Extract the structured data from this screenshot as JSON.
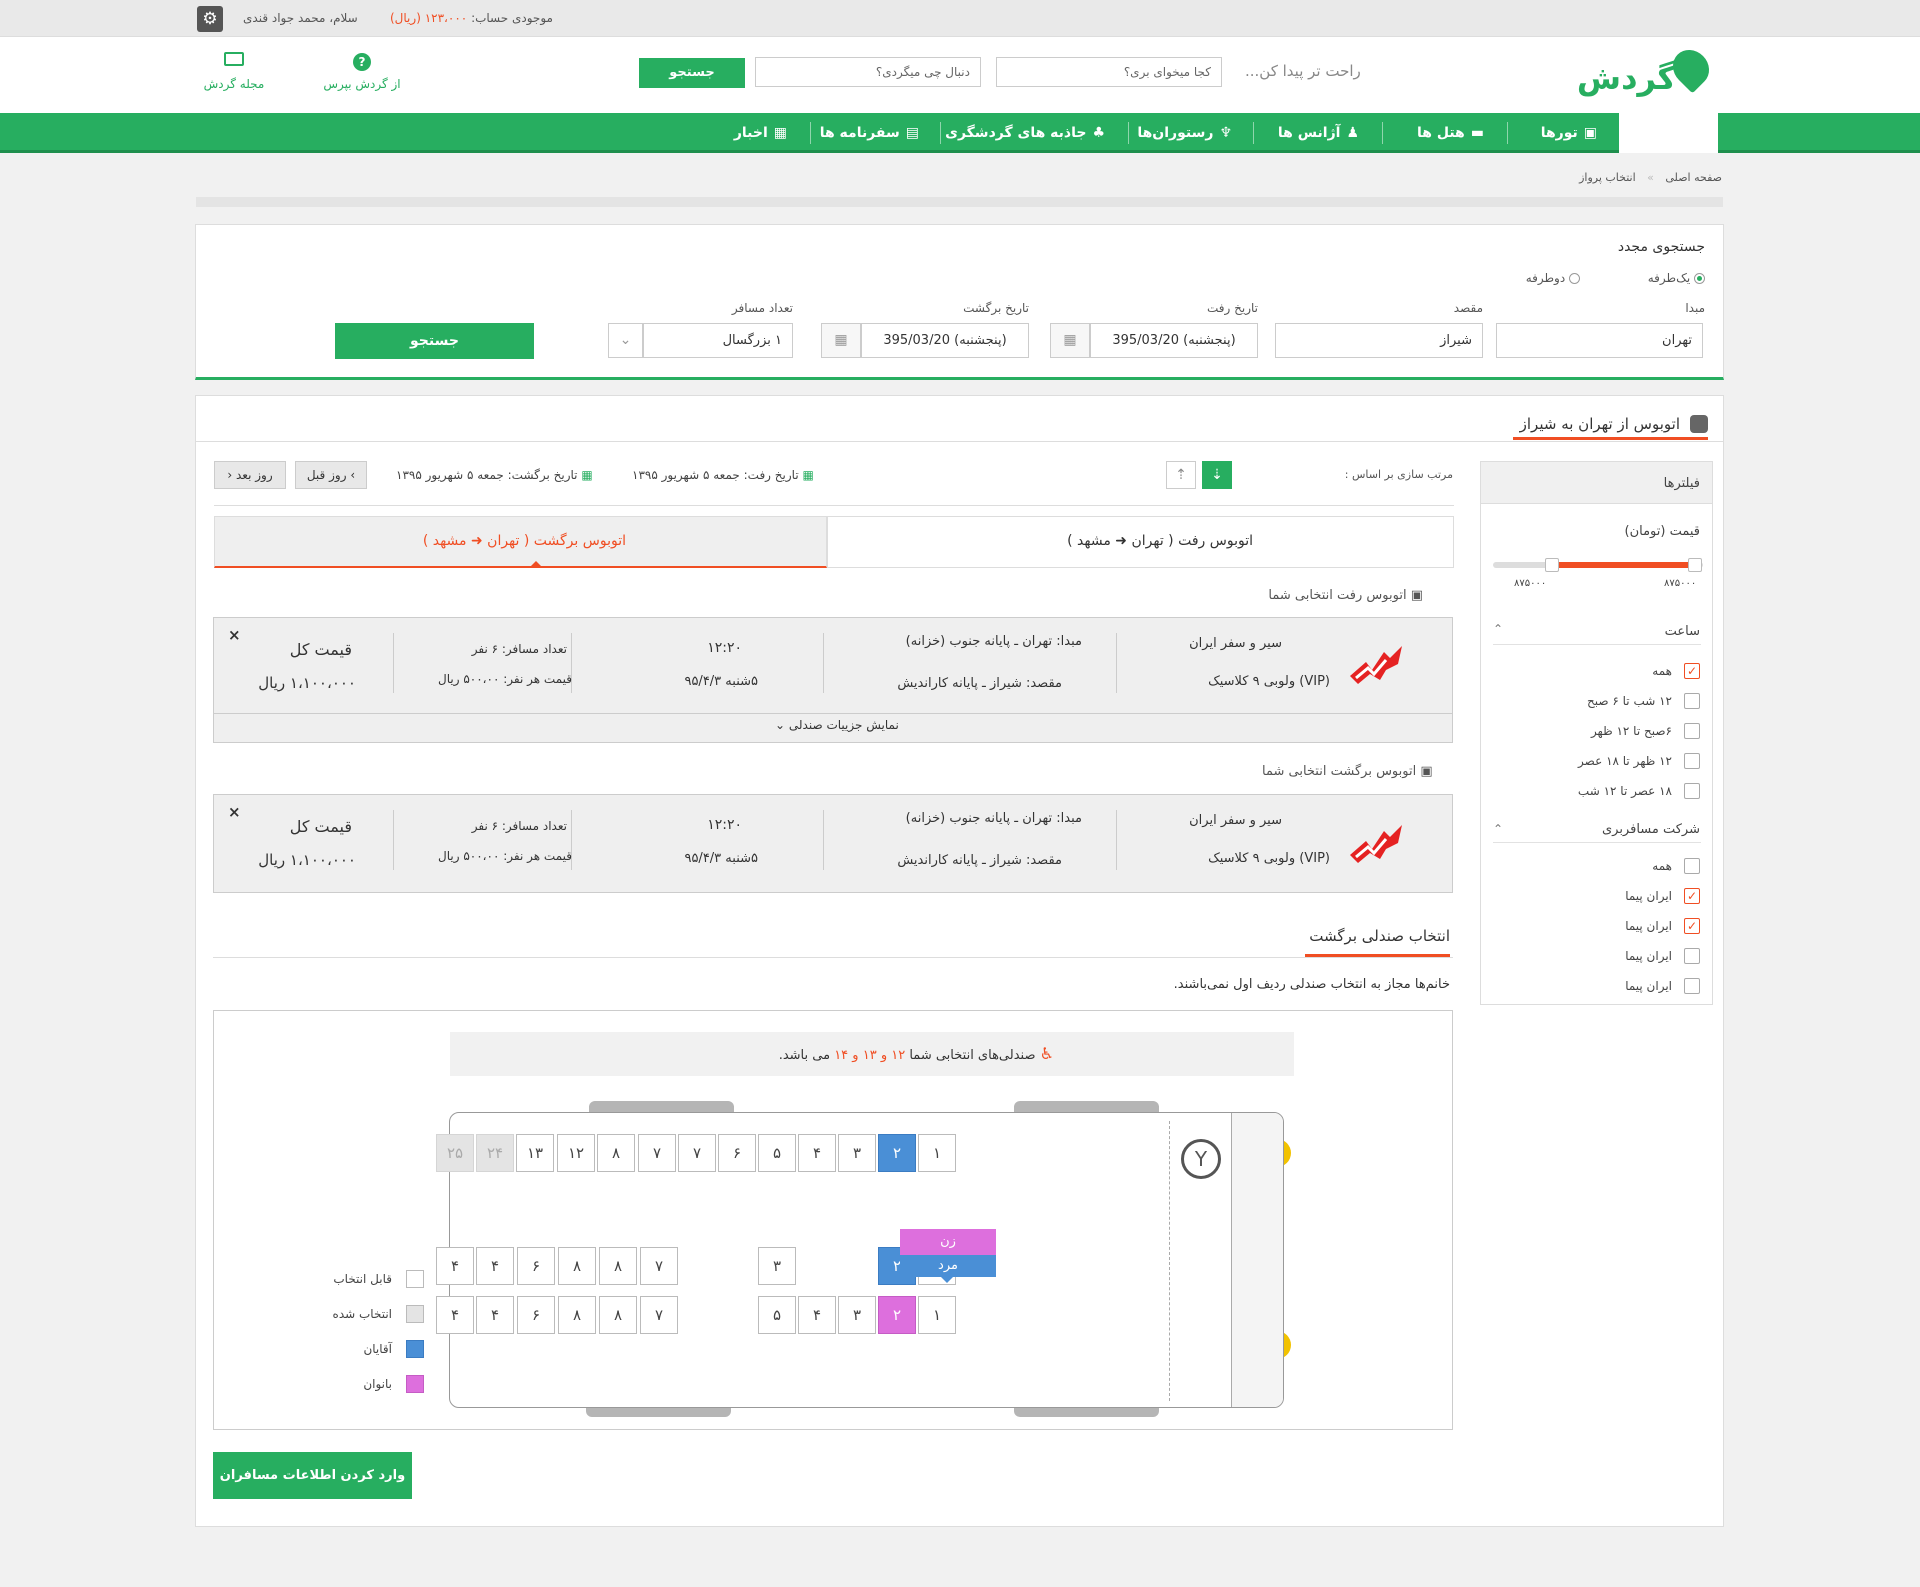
{
  "topbar": {
    "balance_label": "موجودی حساب:",
    "balance_value": "۱۲۳،۰۰۰ (ریال)",
    "greeting": "سلام، محمد جواد قندی"
  },
  "header": {
    "logo_text": "گردش",
    "hint": "راحت تر پیدا کن...",
    "where_placeholder": "کجا میخوای بری؟",
    "what_placeholder": "دنبال چی میگردی؟",
    "search_label": "جستجو",
    "ask_label": "از گردش بپرس",
    "magazine_label": "مجله گردش"
  },
  "nav": {
    "items": [
      "خانه",
      "تورها",
      "هتل ها",
      "آژانس ها",
      "رستوران‌ها",
      "جاذبه های گردشگری",
      "سفرنامه ها",
      "اخبار"
    ]
  },
  "breadcrumb": {
    "home": "صفحه اصلی",
    "sep": "»",
    "current": "انتخاب پرواز"
  },
  "research": {
    "title": "جستجوی مجدد",
    "oneway": "یک‌طرفه",
    "roundtrip": "دوطرفه",
    "origin_label": "مبدا",
    "origin_value": "تهران",
    "dest_label": "مقصد",
    "dest_value": "شیراز",
    "depart_label": "تاریخ رفت",
    "depart_value": "395/03/20 (پنجشنبه)",
    "return_label": "تاریخ برگشت",
    "return_value": "395/03/20 (پنجشنبه)",
    "passengers_label": "تعداد مسافر",
    "passengers_value": "۱ بزرگسال",
    "search_button": "جستجو"
  },
  "results": {
    "title": "اتوبوس از تهران به شیراز",
    "sort_label": "مرتب سازی بر اساس :",
    "depart_date": "تاریخ رفت: جمعه ۵ شهریور ۱۳۹۵",
    "return_date": "تاریخ برگشت: جمعه ۵ شهریور ۱۳۹۵",
    "prev_day": "روز قبل",
    "next_day": "روز بعد",
    "tab_outbound": "اتوبوس رفت",
    "tab_outbound_from": "( تهران",
    "tab_outbound_to": "مشهد )",
    "tab_return": "اتوبوس برگشت",
    "tab_return_from": "( تهران",
    "tab_return_to": "مشهد )",
    "selected_outbound_title": "اتوبوس رفت انتخابی شما",
    "selected_return_title": "اتوبوس برگشت انتخابی شما",
    "show_seat_details": "نمایش جزییات صندلی"
  },
  "trip": {
    "company": "سیر و سفر ایران",
    "bus_type": "(VIP) ولوبی ۹ کلاسیک",
    "origin": "مبدا: تهران ـ پایانه جنوب (خزانه)",
    "destination": "مقصد: شیراز ـ پایانه کاراندیش",
    "time": "۱۲:۲۰",
    "date": "۵شنبه ۹۵/۴/۳",
    "passengers": "تعداد مسافر:  ۶ نفر",
    "per_person": "قیمت هر نفر: ۵۰۰،۰۰ ریال",
    "total_label": "قیمت کل",
    "total_value": "۱،۱۰۰،۰۰۰ ریال",
    "close": "×"
  },
  "seat_section": {
    "title": "انتخاب صندلی برگشت",
    "note": "خانم‌ها مجاز به انتخاب صندلی ردیف اول نمی‌باشند.",
    "selected_prefix": "صندلی‌های انتخابی شما",
    "selected_seats": "۱۲ و ۱۳ و ۱۴",
    "selected_suffix": "می باشد.",
    "popup_female": "زن",
    "popup_male": "مرد",
    "legend_available": "قابل انتخاب",
    "legend_taken": "انتخاب شده",
    "legend_men": "آقایان",
    "legend_women": "بانوان",
    "submit": "وارد کردن اطلاعات مسافران"
  },
  "seats": {
    "row1": [
      "۱",
      "۲",
      "۳",
      "۴",
      "۵",
      "۶",
      "۷",
      "۷",
      "۸",
      "۱۲",
      "۱۳",
      "۲۴",
      "۲۵"
    ],
    "row2": [
      "۱",
      "۲",
      "۳",
      "۷",
      "۸",
      "۸",
      "۶",
      "۴",
      "۴"
    ],
    "row3": [
      "۱",
      "۲",
      "۳",
      "۴",
      "۵",
      "۷",
      "۸",
      "۸",
      "۶",
      "۴",
      "۴"
    ]
  },
  "filters": {
    "title": "فیلترها",
    "price_label": "قیمت (تومان)",
    "price_min": "۸۷۵۰۰۰",
    "price_max": "۸۷۵۰۰۰",
    "price_range_fraction": [
      0.28,
      0.96
    ],
    "time_label": "ساعت",
    "time_options": [
      "همه",
      "۱۲ شب تا ۶ صبح",
      "۶صبح تا ۱۲ ظهر",
      "۱۲ ظهر تا ۱۸ عصر",
      "۱۸ عصر تا ۱۲ شب"
    ],
    "company_label": "شرکت مسافربری",
    "company_options": [
      "همه",
      "ایران پیما",
      "ایران پیما",
      "ایران پیما",
      "ایران پیما"
    ]
  },
  "colors": {
    "brand_green": "#27ae60",
    "accent_orange": "#f04e23",
    "seat_men": "#4a8fd6",
    "seat_women": "#dd6fdd"
  }
}
